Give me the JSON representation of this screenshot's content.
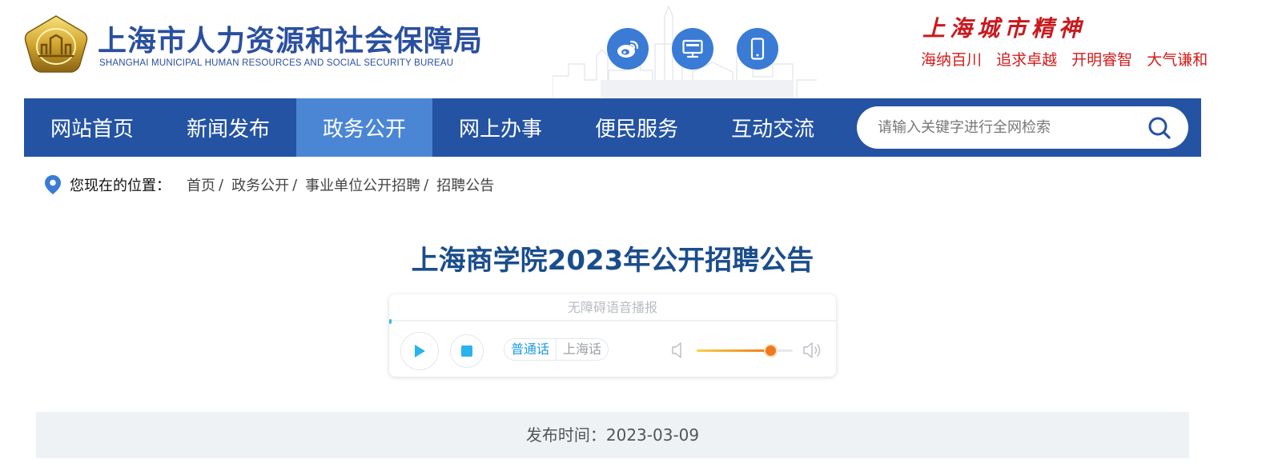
{
  "header": {
    "org_name_cn": "上海市人力资源和社会保障局",
    "org_name_en": "SHANGHAI MUNICIPAL HUMAN RESOURCES AND SOCIAL SECURITY BUREAU",
    "icons": [
      "weibo-icon",
      "desktop-icon",
      "mobile-icon"
    ],
    "spirit_title": "上海城市精神",
    "spirit_motto": [
      "海纳百川",
      "追求卓越",
      "开明睿智",
      "大气谦和"
    ]
  },
  "nav": {
    "items": [
      "网站首页",
      "新闻发布",
      "政务公开",
      "网上办事",
      "便民服务",
      "互动交流"
    ],
    "active": "政务公开",
    "search_placeholder": "请输入关键字进行全网检索"
  },
  "breadcrumb": {
    "label": "您现在的位置：",
    "items": [
      "首页",
      "政务公开",
      "事业单位公开招聘",
      "招聘公告"
    ],
    "separator": "/"
  },
  "article": {
    "title": "上海商学院2023年公开招聘公告",
    "publish_label": "发布时间：2023-03-09"
  },
  "player": {
    "title": "无障碍语音播报",
    "dialects": [
      "普通话",
      "上海话"
    ],
    "active_dialect": "普通话",
    "volume_fraction": 0.77
  },
  "colors": {
    "nav_bg": "#2453a3",
    "nav_active": "#4b86d4",
    "title_blue": "#1a4d8c",
    "spirit_red": "#c8191e"
  }
}
